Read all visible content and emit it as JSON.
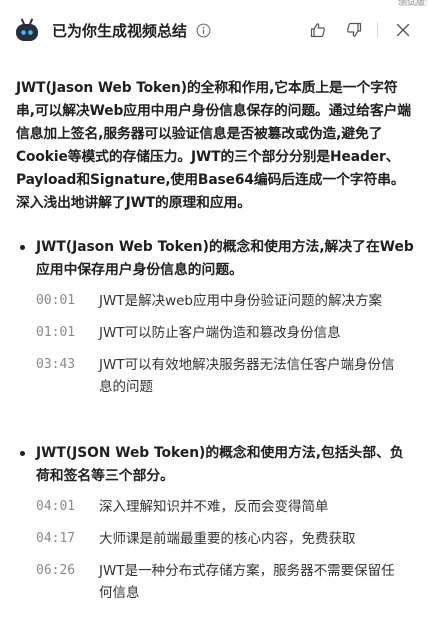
{
  "corner_tag": "测试版",
  "header": {
    "title": "已为你生成视频总结"
  },
  "summary": "JWT(Jason Web Token)的全称和作用,它本质上是一个字符串,可以解决Web应用中用户身份信息保存的问题。通过给客户端信息加上签名,服务器可以验证信息是否被篡改或伪造,避免了Cookie等模式的存储压力。JWT的三个部分分别是Header、Payload和Signature,使用Base64编码后连成一个字符串。深入浅出地讲解了JWT的原理和应用。",
  "sections": [
    {
      "title": "JWT(Jason Web Token)的概念和使用方法,解决了在Web应用中保存用户身份信息的问题。",
      "entries": [
        {
          "time": "00:01",
          "text": "JWT是解决web应用中身份验证问题的解决方案"
        },
        {
          "time": "01:01",
          "text": "JWT可以防止客户端伪造和篡改身份信息"
        },
        {
          "time": "03:43",
          "text": "JWT可以有效地解决服务器无法信任客户端身份信息的问题"
        }
      ]
    },
    {
      "title": "JWT(JSON Web Token)的概念和使用方法,包括头部、负荷和签名等三个部分。",
      "entries": [
        {
          "time": "04:01",
          "text": "深入理解知识并不难，反而会变得简单"
        },
        {
          "time": "04:17",
          "text": "大师课是前端最重要的核心内容，免费获取"
        },
        {
          "time": "06:26",
          "text": "JWT是一种分布式存储方案，服务器不需要保留任何信息"
        }
      ]
    }
  ]
}
